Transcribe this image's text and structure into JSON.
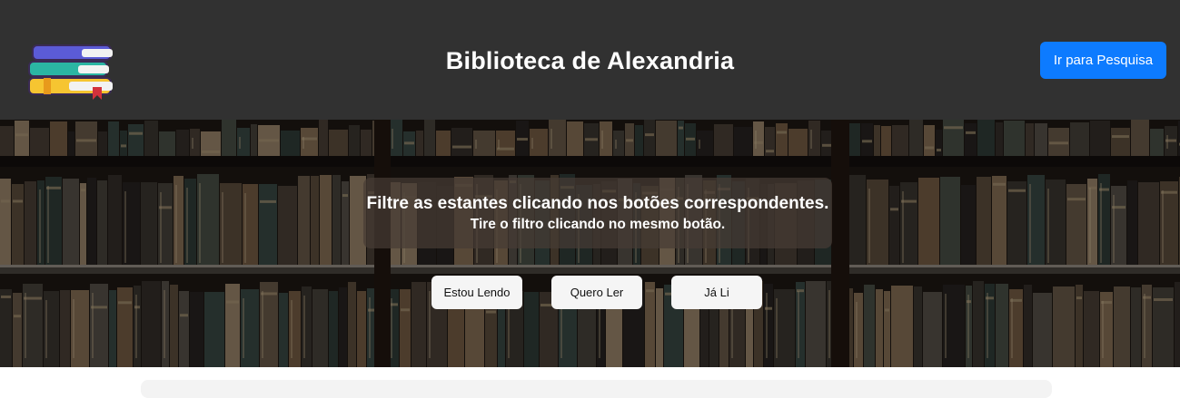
{
  "header": {
    "logo_icon": "books-stack-icon",
    "title": "Biblioteca de Alexandria",
    "search_button_label": "Ir para Pesquisa",
    "background_color": "#313131",
    "button_color": "#0d7bff"
  },
  "hero": {
    "background_image": "library-bookshelves",
    "caption_main": "Filtre as estantes clicando nos botões correspondentes.",
    "caption_sub": "Tire o filtro clicando no mesmo botão."
  },
  "filters": {
    "reading_label": "Estou Lendo",
    "want_to_read_label": "Quero Ler",
    "read_label": "Já Li"
  }
}
